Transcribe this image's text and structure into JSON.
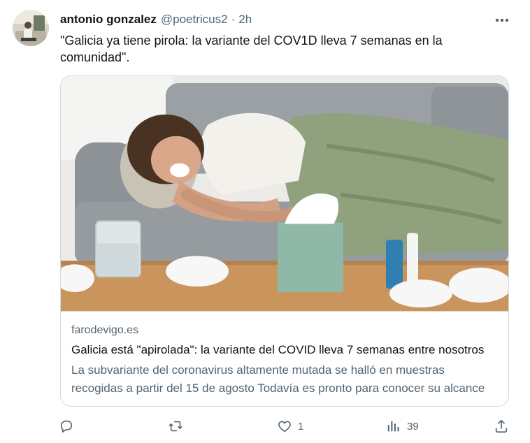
{
  "tweet": {
    "author_name": "antonio gonzalez",
    "author_handle": "@poetricus2",
    "separator": "·",
    "time": "2h",
    "text": "\"Galicia ya tiene pirola: la variante del COV1D lleva 7 semanas en la comunidad\"."
  },
  "card": {
    "domain": "farodevigo.es",
    "title": "Galicia está \"apirolada\": la variante del COVID lleva 7 semanas entre nosotros",
    "description": "La subvariante del coronavirus altamente mutada se halló en muestras recogidas a partir del 15 de agosto Todavía es pronto para conocer su alcance"
  },
  "actions": {
    "reply_icon": "reply-icon",
    "retweet_icon": "retweet-icon",
    "like_icon": "heart-icon",
    "like_count": "1",
    "views_icon": "views-icon",
    "views_count": "39",
    "share_icon": "share-icon"
  },
  "colors": {
    "text": "#0f1419",
    "secondary": "#536471",
    "border": "#cfd9de"
  }
}
